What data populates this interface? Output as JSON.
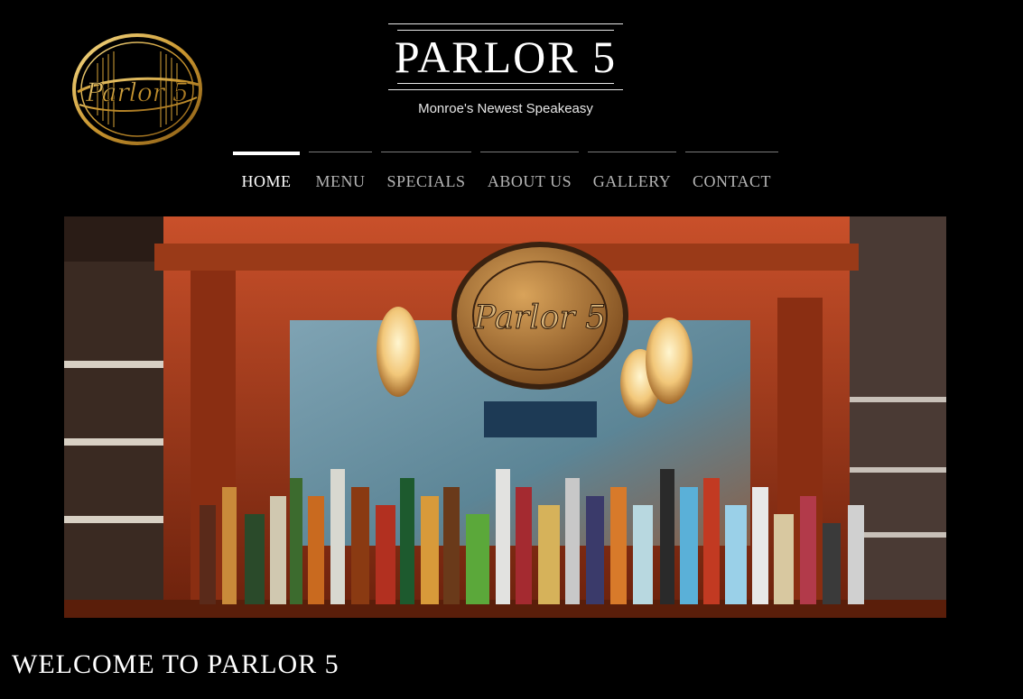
{
  "header": {
    "logo_text": "Parlor 5",
    "site_title": "PARLOR 5",
    "tagline": "Monroe's Newest Speakeasy"
  },
  "nav": {
    "items": [
      {
        "label": "HOME",
        "active": true
      },
      {
        "label": "MENU",
        "active": false
      },
      {
        "label": "SPECIALS",
        "active": false
      },
      {
        "label": "ABOUT US",
        "active": false
      },
      {
        "label": "GALLERY",
        "active": false
      },
      {
        "label": "CONTACT",
        "active": false
      }
    ]
  },
  "hero": {
    "sign_text": "Parlor 5"
  },
  "main": {
    "heading": "WELCOME TO PARLOR 5"
  },
  "colors": {
    "background": "#000000",
    "text": "#ffffff",
    "nav_inactive": "#b5b5b5",
    "gold": "#c9a040",
    "wood": "#7a2a10"
  }
}
